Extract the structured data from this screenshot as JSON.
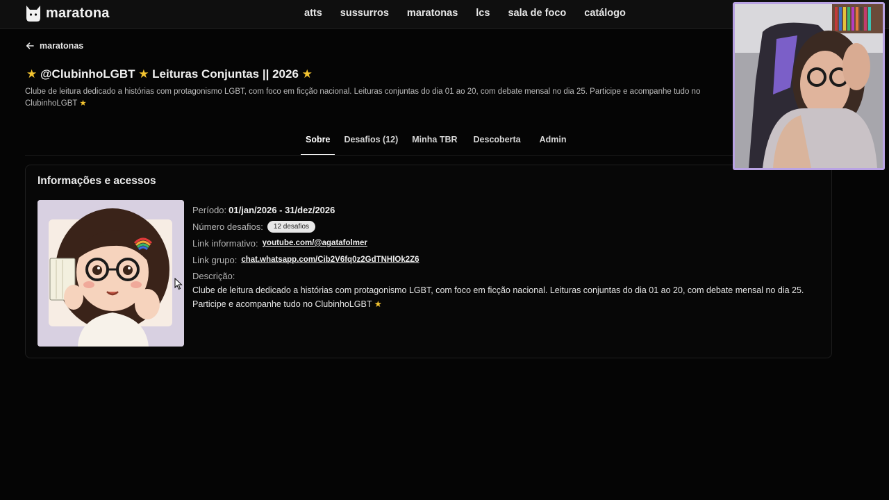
{
  "app": {
    "logo_text": "maratona",
    "nav": [
      "atts",
      "sussurros",
      "maratonas",
      "lcs",
      "sala de foco",
      "catálogo"
    ]
  },
  "back": {
    "label": "maratonas"
  },
  "header": {
    "title_text": "@ClubinhoLGBT ★ Leituras Conjuntas || 2026",
    "subtitle": "Clube de leitura dedicado a histórias com protagonismo LGBT, com foco em ficção nacional. Leituras conjuntas do dia 01 ao 20, com debate mensal no dia 25. Participe e acompanhe tudo no ClubinhoLGBT ★"
  },
  "tabs": [
    {
      "label": "Sobre",
      "active": true
    },
    {
      "label": "Desafios (12)",
      "active": false
    },
    {
      "label": "Minha TBR",
      "active": false
    },
    {
      "label": "Descoberta",
      "active": false
    },
    {
      "label": "Admin",
      "active": false
    }
  ],
  "card": {
    "title": "Informações e acessos",
    "periodo_label": "Período:",
    "periodo_value": "01/jan/2026 - 31/dez/2026",
    "desafios_label": "Número desafios:",
    "desafios_badge": "12 desafios",
    "link_info_label": "Link informativo:",
    "link_info_value": "youtube.com/@agatafolmer",
    "link_grupo_label": "Link grupo:",
    "link_grupo_value": "chat.whatsapp.com/Cib2V6fq0z2GdTNHlOk2Z6",
    "descricao_label": "Descrição:",
    "descricao_text": "Clube de leitura dedicado a histórias com protagonismo LGBT, com foco em ficção nacional. Leituras conjuntas do dia 01 ao 20, com debate mensal no dia 25. Participe e acompanhe tudo no ClubinhoLGBT ★"
  },
  "colors": {
    "background": "#050505",
    "star": "#f4c430",
    "cam_border": "#b9a3e3"
  }
}
